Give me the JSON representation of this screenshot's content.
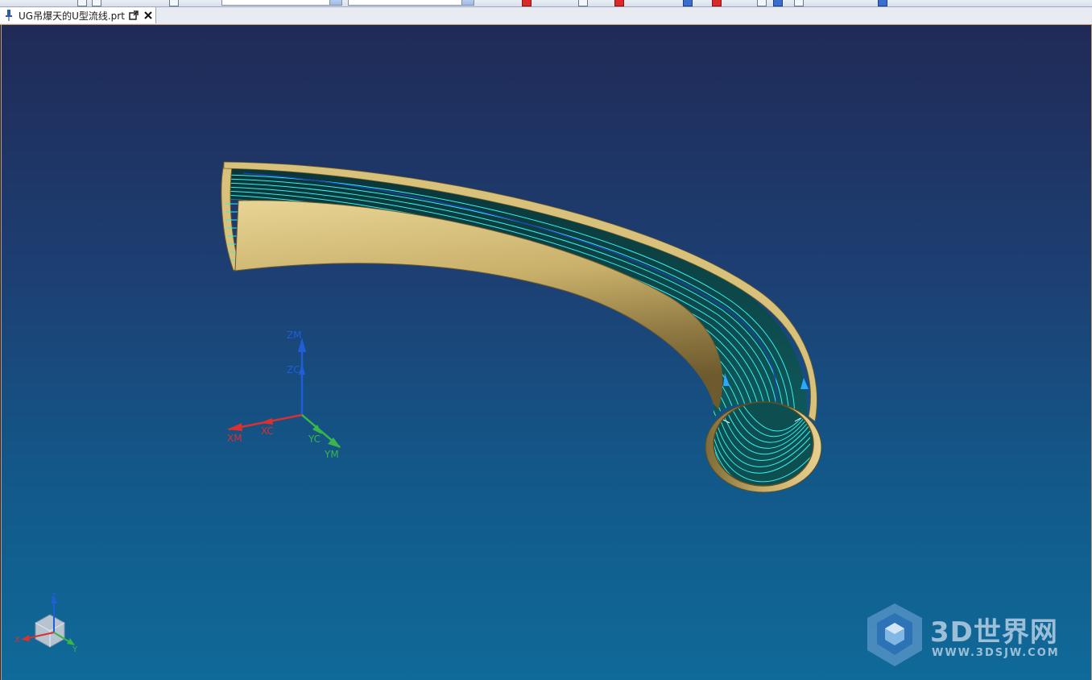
{
  "tab": {
    "title": "UG吊爆天的U型流线.prt",
    "pin_icon": "pin-icon",
    "popout_icon": "popout-icon",
    "close_icon": "close-icon"
  },
  "wcs_triad": {
    "labels": {
      "xm": "XM",
      "xc": "XC",
      "yc": "YC",
      "ym": "YM",
      "zm": "ZM",
      "zc": "ZC"
    },
    "colors": {
      "x": "#d93030",
      "y": "#39b54a",
      "z": "#1f5ed6"
    }
  },
  "view_triad": {
    "labels": {
      "x": "X",
      "y": "Y",
      "z": "Z"
    }
  },
  "model": {
    "outer_color": "#d8c17a",
    "inner_color": "#0c4a4e",
    "toolpath_color": "#33f0f0"
  },
  "watermark": {
    "text": "3D世界网",
    "sub": "WWW.3DSJW.COM"
  }
}
